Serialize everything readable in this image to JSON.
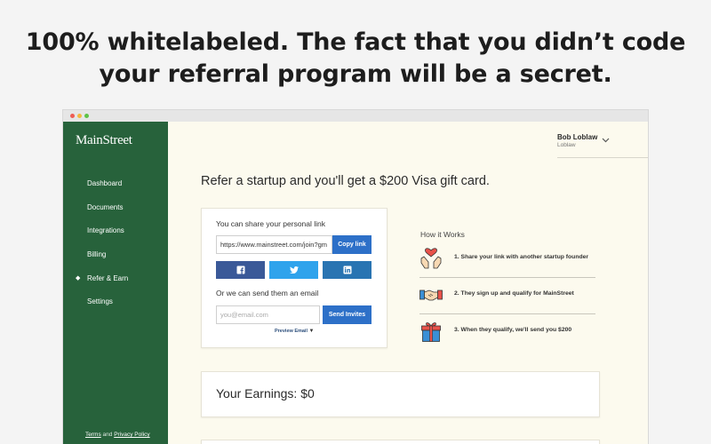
{
  "headline": {
    "line1": "100% whitelabeled. The fact that you didn’t code",
    "line2": "your referral program will be a secret."
  },
  "sidebar": {
    "brand": "MainStreet",
    "items": [
      {
        "label": "Dashboard",
        "active": false
      },
      {
        "label": "Documents",
        "active": false
      },
      {
        "label": "Integrations",
        "active": false
      },
      {
        "label": "Billing",
        "active": false
      },
      {
        "label": "Refer & Earn",
        "active": true
      },
      {
        "label": "Settings",
        "active": false
      }
    ],
    "active_marker": "◆",
    "footer": {
      "terms": "Terms",
      "and": "and",
      "privacy": "Privacy Policy"
    },
    "bg_color": "#27623b"
  },
  "user": {
    "name": "Bob Loblaw",
    "subtitle": "Loblaw"
  },
  "page": {
    "title": "Refer a startup and you'll get a $200 Visa gift card."
  },
  "share": {
    "link_label": "You can share your personal link",
    "link_value": "https://www.mainstreet.com/join?gm",
    "copy_button": "Copy link",
    "social": [
      {
        "network": "facebook",
        "icon": "facebook-icon",
        "color": "#3a5998"
      },
      {
        "network": "twitter",
        "icon": "twitter-icon",
        "color": "#2fa3ec"
      },
      {
        "network": "linkedin",
        "icon": "linkedin-icon",
        "color": "#2974b2"
      }
    ],
    "email_label": "Or we can send them an email",
    "email_placeholder": "you@email.com",
    "send_button": "Send Invites",
    "preview": "Preview Email",
    "preview_arrow": "▼"
  },
  "how_it_works": {
    "title": "How it Works",
    "steps": [
      {
        "icon": "heart-hands-icon",
        "text": "1. Share your link with another startup founder"
      },
      {
        "icon": "handshake-icon",
        "text": "2. They sign up and qualify for MainStreet"
      },
      {
        "icon": "gift-icon",
        "text": "3. When they qualify, we'll send you $200"
      }
    ]
  },
  "earnings": {
    "text": "Your Earnings: $0"
  },
  "accent_color": "#2d70c8"
}
